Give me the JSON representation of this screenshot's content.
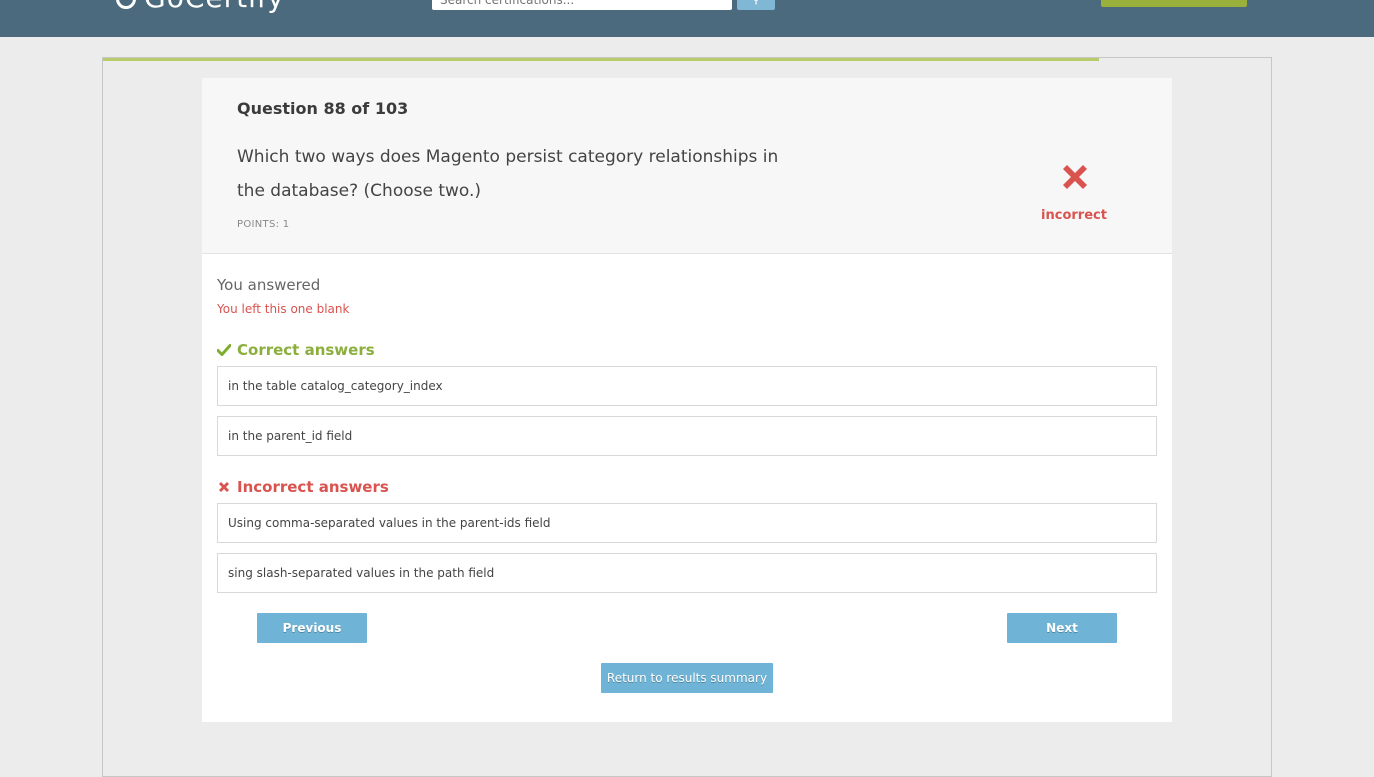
{
  "header": {
    "logo_text": "GoCertify",
    "search_placeholder": "Search certifications...",
    "search_button_icon": "search-icon",
    "cta_label": ""
  },
  "progress": {
    "completed_fraction": 0.85
  },
  "question": {
    "counter": "Question 88 of 103",
    "text": "Which two ways does Magento persist category relationships in the database? (Choose two.)",
    "points": "POINTS: 1",
    "result_icon": "x-icon",
    "result_label": "incorrect"
  },
  "your_answer": {
    "heading": "You answered",
    "value": "You left this one blank"
  },
  "correct_answers": {
    "heading": "Correct answers",
    "icon": "checkmark-icon",
    "items": [
      "in the table catalog_category_index",
      "in the parent_id field"
    ]
  },
  "incorrect_answers": {
    "heading": "Incorrect answers",
    "icon": "x-icon",
    "items": [
      "Using comma-separated values in the parent-ids field",
      "sing slash-separated values in the path field"
    ]
  },
  "buttons": {
    "previous": "Previous",
    "next": "Next",
    "return": "Return to results summary"
  },
  "colors": {
    "header_bg": "#4b6a7d",
    "accent_green": "#8cae3c",
    "error_red": "#d9534f",
    "button_blue": "#6fb4d6"
  }
}
